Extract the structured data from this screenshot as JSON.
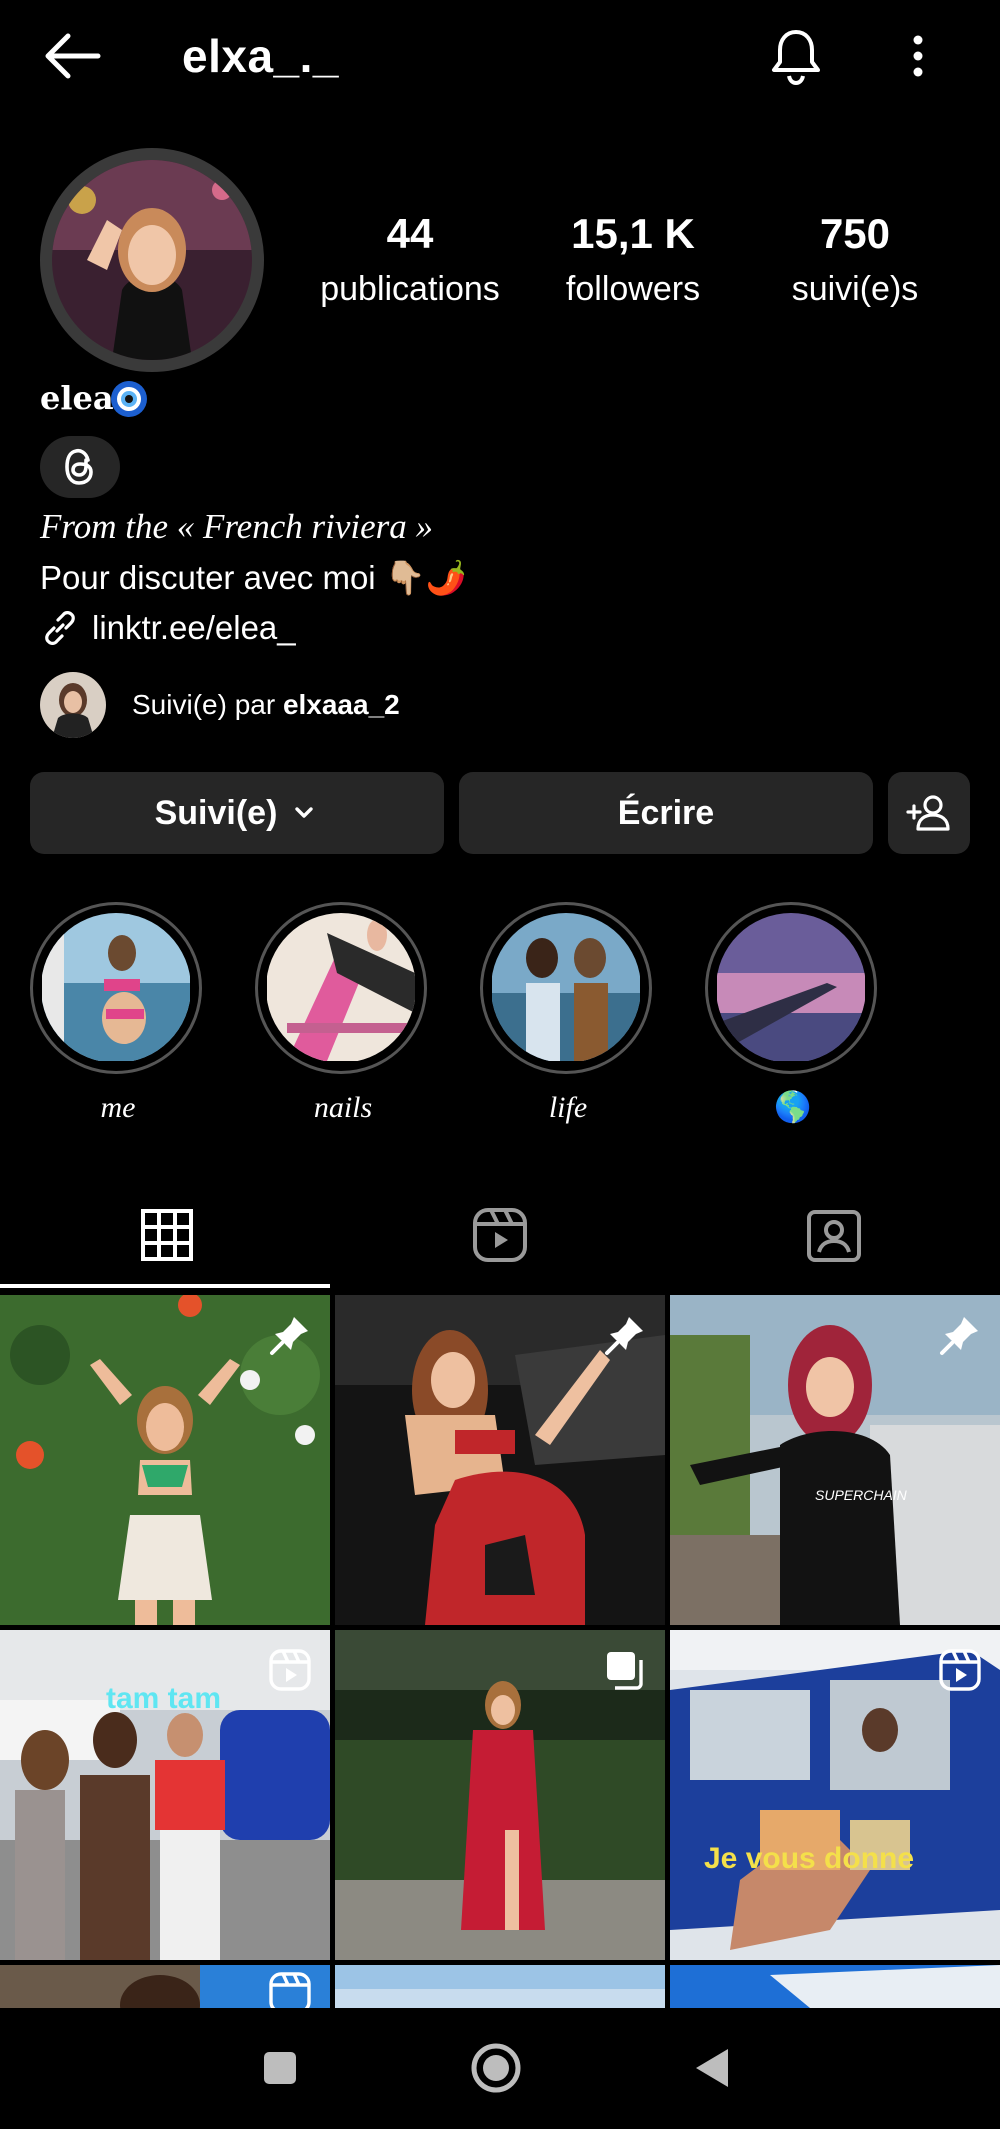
{
  "header": {
    "username": "elxa_._"
  },
  "stats": [
    {
      "value": "44",
      "label": "publications"
    },
    {
      "value": "15,1 K",
      "label": "followers"
    },
    {
      "value": "750",
      "label": "suivi(e)s"
    }
  ],
  "profile": {
    "display_name": "elea",
    "bio_line1": "From the « French riviera »",
    "bio_line2": "Pour discuter avec moi 👇🏼🌶️",
    "link": "linktr.ee/elea_",
    "followed_by_prefix": "Suivi(e) par ",
    "followed_by_user": "elxaaa_2"
  },
  "actions": {
    "following_label": "Suivi(e)",
    "message_label": "Écrire"
  },
  "highlights": [
    {
      "label": "me"
    },
    {
      "label": "nails"
    },
    {
      "label": "life"
    },
    {
      "label": "🌎"
    }
  ],
  "grid_overlays": {
    "post4_text": "tam tam",
    "post6_text": "Je vous donne"
  },
  "icons": {
    "back": "back-arrow-icon",
    "bell": "bell-icon",
    "more": "more-vertical-icon",
    "threads": "threads-icon",
    "link": "link-icon",
    "chevron": "chevron-down-icon",
    "add_person": "add-person-icon",
    "grid": "grid-icon",
    "reels": "reels-icon",
    "tagged": "tagged-icon",
    "pin": "pin-icon",
    "reel_badge": "reel-badge-icon",
    "carousel": "carousel-icon"
  },
  "colors": {
    "background": "#000000",
    "button": "#262626",
    "text": "#ffffff",
    "verified_eye": "#1c5fd0"
  }
}
